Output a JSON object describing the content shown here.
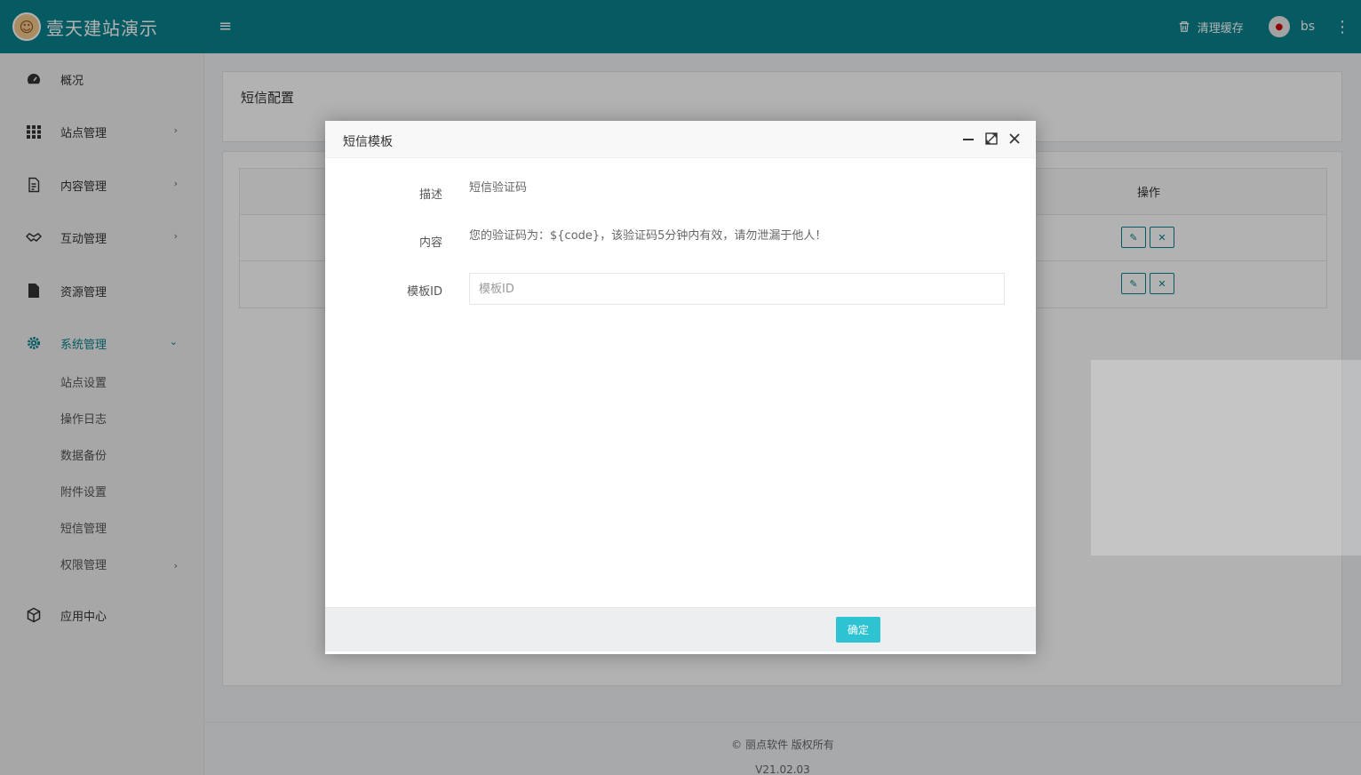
{
  "header": {
    "site_name": "壹天建站演示",
    "clear_cache": "清理缓存",
    "user_name": "bs"
  },
  "sidebar": {
    "items": [
      {
        "label": "概况"
      },
      {
        "label": "站点管理"
      },
      {
        "label": "内容管理"
      },
      {
        "label": "互动管理"
      },
      {
        "label": "资源管理"
      },
      {
        "label": "系统管理"
      },
      {
        "label": "应用中心"
      }
    ],
    "sub_items": [
      {
        "label": "站点设置"
      },
      {
        "label": "操作日志"
      },
      {
        "label": "数据备份"
      },
      {
        "label": "附件设置"
      },
      {
        "label": "短信管理"
      },
      {
        "label": "权限管理"
      }
    ]
  },
  "main": {
    "card_title": "短信配置",
    "table": {
      "op_header": "操作"
    },
    "footer": {
      "copyright": "© 丽点软件 版权所有",
      "version": "V21.02.03"
    }
  },
  "modal": {
    "title": "短信模板",
    "fields": {
      "desc_label": "描述",
      "desc_value": "短信验证码",
      "content_label": "内容",
      "content_value": "您的验证码为：${code}，该验证码5分钟内有效，请勿泄漏于他人！",
      "template_label": "模板ID",
      "template_placeholder": "模板ID"
    },
    "ok_label": "确定"
  }
}
